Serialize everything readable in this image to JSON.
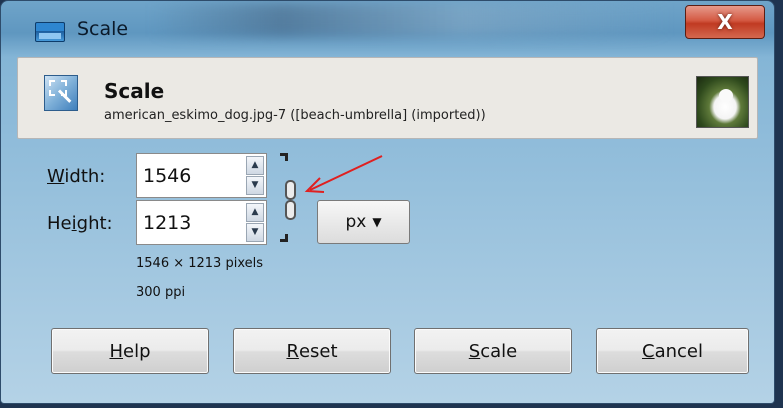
{
  "window": {
    "title": "Scale",
    "close_label": "X"
  },
  "header": {
    "title": "Scale",
    "subtitle": "american_eskimo_dog.jpg-7 ([beach-umbrella] (imported))"
  },
  "form": {
    "width_label_first": "W",
    "width_label_rest": "idth:",
    "width_value": "1546",
    "height_label_first": "H",
    "height_label_mid": "e",
    "height_label_ul": "i",
    "height_label_rest": "ght:",
    "height_value": "1213",
    "unit_value": "px",
    "pixels_info": "1546 × 1213 pixels",
    "ppi_info": "300 ppi"
  },
  "buttons": {
    "help_first": "H",
    "help_rest": "elp",
    "reset_first": "R",
    "reset_rest": "eset",
    "scale_first": "S",
    "scale_rest": "cale",
    "cancel_first": "C",
    "cancel_rest": "ancel"
  },
  "colors": {
    "annotation_arrow": "#e02020",
    "close_button": "#c94b35"
  }
}
